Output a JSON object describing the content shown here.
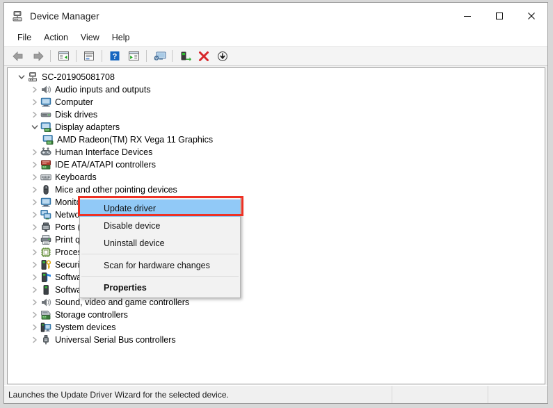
{
  "window": {
    "title": "Device Manager",
    "icon": "device-manager-icon",
    "caption": {
      "minimize": "—",
      "maximize": "☐",
      "close": "✕"
    }
  },
  "menubar": {
    "items": [
      {
        "label": "File",
        "name": "menu-file"
      },
      {
        "label": "Action",
        "name": "menu-action"
      },
      {
        "label": "View",
        "name": "menu-view"
      },
      {
        "label": "Help",
        "name": "menu-help"
      }
    ]
  },
  "toolbar": {
    "buttons": [
      {
        "name": "back-button",
        "icon": "back-arrow-icon"
      },
      {
        "name": "forward-button",
        "icon": "forward-arrow-icon"
      },
      {
        "name": "separator-1",
        "icon": "separator"
      },
      {
        "name": "show-hide-console-tree-button",
        "icon": "console-tree-icon"
      },
      {
        "name": "separator-2",
        "icon": "separator"
      },
      {
        "name": "properties-button",
        "icon": "properties-window-icon"
      },
      {
        "name": "separator-3",
        "icon": "separator"
      },
      {
        "name": "help-button",
        "icon": "help-question-icon"
      },
      {
        "name": "show-hide-action-pane-button",
        "icon": "action-pane-icon"
      },
      {
        "name": "separator-4",
        "icon": "separator"
      },
      {
        "name": "scan-for-hardware-changes-button",
        "icon": "scan-monitor-icon"
      },
      {
        "name": "separator-5",
        "icon": "separator"
      },
      {
        "name": "update-driver-button",
        "icon": "update-driver-icon"
      },
      {
        "name": "uninstall-device-button",
        "icon": "red-x-icon"
      },
      {
        "name": "disable-device-button",
        "icon": "down-arrow-circle-icon"
      }
    ]
  },
  "tree": {
    "root": {
      "label": "SC-201905081708",
      "icon": "computer-root-icon",
      "expanded": true
    },
    "nodes": [
      {
        "label": "Audio inputs and outputs",
        "icon": "speaker-icon",
        "expanded": false
      },
      {
        "label": "Computer",
        "icon": "monitor-icon",
        "expanded": false
      },
      {
        "label": "Disk drives",
        "icon": "disk-drive-icon",
        "expanded": false
      },
      {
        "label": "Display adapters",
        "icon": "display-adapter-icon",
        "expanded": true
      },
      {
        "label": "Human Interface Devices",
        "icon": "hid-gamepad-icon",
        "expanded": false
      },
      {
        "label": "IDE ATA/ATAPI controllers",
        "icon": "ide-controller-icon",
        "expanded": false
      },
      {
        "label": "Keyboards",
        "icon": "keyboard-icon",
        "expanded": false
      },
      {
        "label": "Mice and other pointing devices",
        "icon": "mouse-icon",
        "expanded": false
      },
      {
        "label": "Monitors",
        "icon": "monitor-icon",
        "expanded": false
      },
      {
        "label": "Network adapters",
        "icon": "network-adapter-icon",
        "expanded": false
      },
      {
        "label": "Ports (COM & LPT)",
        "icon": "port-icon",
        "expanded": false
      },
      {
        "label": "Print queues",
        "icon": "printer-icon",
        "expanded": false
      },
      {
        "label": "Processors",
        "icon": "processor-icon",
        "expanded": false
      },
      {
        "label": "Security devices",
        "icon": "security-key-icon",
        "expanded": false
      },
      {
        "label": "Software components",
        "icon": "software-component-icon",
        "expanded": false
      },
      {
        "label": "Software devices",
        "icon": "software-device-icon",
        "expanded": false
      },
      {
        "label": "Sound, video and game controllers",
        "icon": "speaker-icon",
        "expanded": false
      },
      {
        "label": "Storage controllers",
        "icon": "storage-controller-icon",
        "expanded": false
      },
      {
        "label": "System devices",
        "icon": "system-device-icon",
        "expanded": false
      },
      {
        "label": "Universal Serial Bus controllers",
        "icon": "usb-icon",
        "expanded": false
      }
    ],
    "selected_device": {
      "label": "AMD Radeon(TM) RX Vega 11 Graphics",
      "icon": "display-adapter-icon"
    }
  },
  "context_menu": {
    "items": [
      {
        "label": "Update driver",
        "name": "ctx-update-driver",
        "highlighted": true,
        "bold": false
      },
      {
        "label": "Disable device",
        "name": "ctx-disable-device",
        "highlighted": false,
        "bold": false
      },
      {
        "label": "Uninstall device",
        "name": "ctx-uninstall-device",
        "highlighted": false,
        "bold": false
      },
      {
        "label": "Scan for hardware changes",
        "name": "ctx-scan-hardware",
        "highlighted": false,
        "bold": false
      },
      {
        "label": "Properties",
        "name": "ctx-properties",
        "highlighted": false,
        "bold": true
      }
    ],
    "highlight_color": "#91c9f7",
    "annotation_color": "#ee3124"
  },
  "statusbar": {
    "message": "Launches the Update Driver Wizard for the selected device.",
    "pane2": "",
    "pane3": ""
  }
}
